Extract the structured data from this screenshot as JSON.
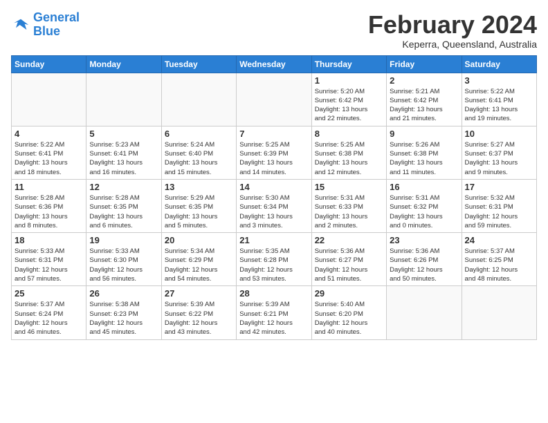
{
  "header": {
    "logo_line1": "General",
    "logo_line2": "Blue",
    "month": "February 2024",
    "location": "Keperra, Queensland, Australia"
  },
  "days_of_week": [
    "Sunday",
    "Monday",
    "Tuesday",
    "Wednesday",
    "Thursday",
    "Friday",
    "Saturday"
  ],
  "weeks": [
    [
      {
        "day": "",
        "info": ""
      },
      {
        "day": "",
        "info": ""
      },
      {
        "day": "",
        "info": ""
      },
      {
        "day": "",
        "info": ""
      },
      {
        "day": "1",
        "info": "Sunrise: 5:20 AM\nSunset: 6:42 PM\nDaylight: 13 hours\nand 22 minutes."
      },
      {
        "day": "2",
        "info": "Sunrise: 5:21 AM\nSunset: 6:42 PM\nDaylight: 13 hours\nand 21 minutes."
      },
      {
        "day": "3",
        "info": "Sunrise: 5:22 AM\nSunset: 6:41 PM\nDaylight: 13 hours\nand 19 minutes."
      }
    ],
    [
      {
        "day": "4",
        "info": "Sunrise: 5:22 AM\nSunset: 6:41 PM\nDaylight: 13 hours\nand 18 minutes."
      },
      {
        "day": "5",
        "info": "Sunrise: 5:23 AM\nSunset: 6:41 PM\nDaylight: 13 hours\nand 16 minutes."
      },
      {
        "day": "6",
        "info": "Sunrise: 5:24 AM\nSunset: 6:40 PM\nDaylight: 13 hours\nand 15 minutes."
      },
      {
        "day": "7",
        "info": "Sunrise: 5:25 AM\nSunset: 6:39 PM\nDaylight: 13 hours\nand 14 minutes."
      },
      {
        "day": "8",
        "info": "Sunrise: 5:25 AM\nSunset: 6:38 PM\nDaylight: 13 hours\nand 12 minutes."
      },
      {
        "day": "9",
        "info": "Sunrise: 5:26 AM\nSunset: 6:38 PM\nDaylight: 13 hours\nand 11 minutes."
      },
      {
        "day": "10",
        "info": "Sunrise: 5:27 AM\nSunset: 6:37 PM\nDaylight: 13 hours\nand 9 minutes."
      }
    ],
    [
      {
        "day": "11",
        "info": "Sunrise: 5:28 AM\nSunset: 6:36 PM\nDaylight: 13 hours\nand 8 minutes."
      },
      {
        "day": "12",
        "info": "Sunrise: 5:28 AM\nSunset: 6:35 PM\nDaylight: 13 hours\nand 6 minutes."
      },
      {
        "day": "13",
        "info": "Sunrise: 5:29 AM\nSunset: 6:35 PM\nDaylight: 13 hours\nand 5 minutes."
      },
      {
        "day": "14",
        "info": "Sunrise: 5:30 AM\nSunset: 6:34 PM\nDaylight: 13 hours\nand 3 minutes."
      },
      {
        "day": "15",
        "info": "Sunrise: 5:31 AM\nSunset: 6:33 PM\nDaylight: 13 hours\nand 2 minutes."
      },
      {
        "day": "16",
        "info": "Sunrise: 5:31 AM\nSunset: 6:32 PM\nDaylight: 13 hours\nand 0 minutes."
      },
      {
        "day": "17",
        "info": "Sunrise: 5:32 AM\nSunset: 6:31 PM\nDaylight: 12 hours\nand 59 minutes."
      }
    ],
    [
      {
        "day": "18",
        "info": "Sunrise: 5:33 AM\nSunset: 6:31 PM\nDaylight: 12 hours\nand 57 minutes."
      },
      {
        "day": "19",
        "info": "Sunrise: 5:33 AM\nSunset: 6:30 PM\nDaylight: 12 hours\nand 56 minutes."
      },
      {
        "day": "20",
        "info": "Sunrise: 5:34 AM\nSunset: 6:29 PM\nDaylight: 12 hours\nand 54 minutes."
      },
      {
        "day": "21",
        "info": "Sunrise: 5:35 AM\nSunset: 6:28 PM\nDaylight: 12 hours\nand 53 minutes."
      },
      {
        "day": "22",
        "info": "Sunrise: 5:36 AM\nSunset: 6:27 PM\nDaylight: 12 hours\nand 51 minutes."
      },
      {
        "day": "23",
        "info": "Sunrise: 5:36 AM\nSunset: 6:26 PM\nDaylight: 12 hours\nand 50 minutes."
      },
      {
        "day": "24",
        "info": "Sunrise: 5:37 AM\nSunset: 6:25 PM\nDaylight: 12 hours\nand 48 minutes."
      }
    ],
    [
      {
        "day": "25",
        "info": "Sunrise: 5:37 AM\nSunset: 6:24 PM\nDaylight: 12 hours\nand 46 minutes."
      },
      {
        "day": "26",
        "info": "Sunrise: 5:38 AM\nSunset: 6:23 PM\nDaylight: 12 hours\nand 45 minutes."
      },
      {
        "day": "27",
        "info": "Sunrise: 5:39 AM\nSunset: 6:22 PM\nDaylight: 12 hours\nand 43 minutes."
      },
      {
        "day": "28",
        "info": "Sunrise: 5:39 AM\nSunset: 6:21 PM\nDaylight: 12 hours\nand 42 minutes."
      },
      {
        "day": "29",
        "info": "Sunrise: 5:40 AM\nSunset: 6:20 PM\nDaylight: 12 hours\nand 40 minutes."
      },
      {
        "day": "",
        "info": ""
      },
      {
        "day": "",
        "info": ""
      }
    ]
  ]
}
